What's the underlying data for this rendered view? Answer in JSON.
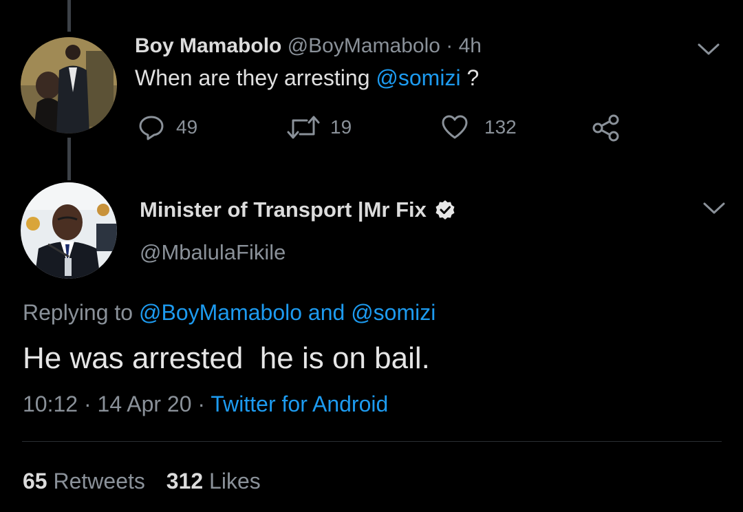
{
  "tweet1": {
    "display_name": "Boy Mamabolo",
    "handle": "@BoyMamabolo",
    "separator": "·",
    "time": "4h",
    "text_before": "When are they arresting ",
    "mention": "@somizi",
    "text_after": " ?",
    "actions": {
      "replies": "49",
      "retweets": "19",
      "likes": "132"
    },
    "icons": [
      "reply-icon",
      "retweet-icon",
      "like-icon",
      "share-icon",
      "chevron-down-icon"
    ]
  },
  "tweet2": {
    "display_name": "Minister of Transport |Mr Fix",
    "handle": "@MbalulaFikile",
    "verified": true,
    "replying_prefix": "Replying to ",
    "replying_user1": "@BoyMamabolo",
    "replying_and": " and ",
    "replying_user2": "@somizi",
    "text": "He was arrested  he is on bail.",
    "time": "10:12",
    "date": "14 Apr 20",
    "separator": "·",
    "source": "Twitter for Android",
    "stats": {
      "retweets_count": "65",
      "retweets_label": "Retweets",
      "likes_count": "312",
      "likes_label": "Likes"
    }
  },
  "colors": {
    "background": "#000000",
    "link": "#1d9bf0",
    "muted": "#8a9199",
    "text": "#dcdcdc"
  }
}
